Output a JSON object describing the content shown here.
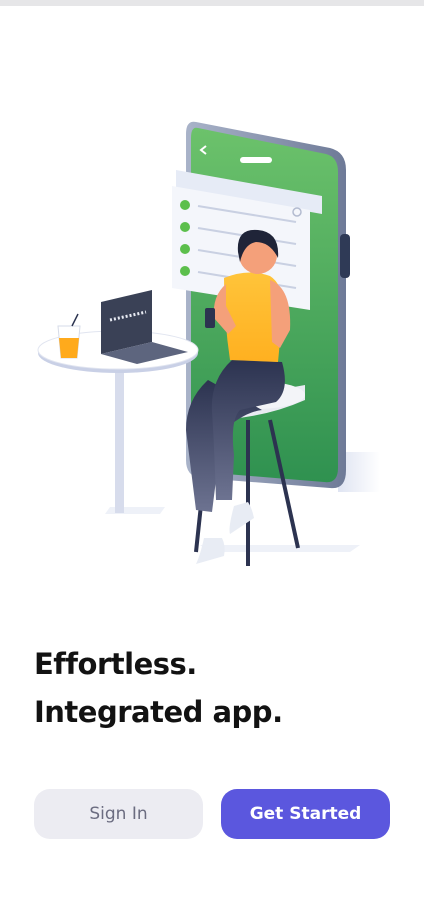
{
  "status_bar": {},
  "hero": {
    "illustration": "woman-sitting-with-phone-and-laptop",
    "checklist_items_checked": 4
  },
  "headline": {
    "line1": "Effortless.",
    "line2": "Integrated app."
  },
  "actions": {
    "sign_in_label": "Sign In",
    "get_started_label": "Get Started"
  },
  "colors": {
    "primary": "#5B57DE",
    "secondary_bg": "#ECECF2",
    "phone_green": "#4CAF50",
    "top_bar": "#E6E6E8"
  }
}
